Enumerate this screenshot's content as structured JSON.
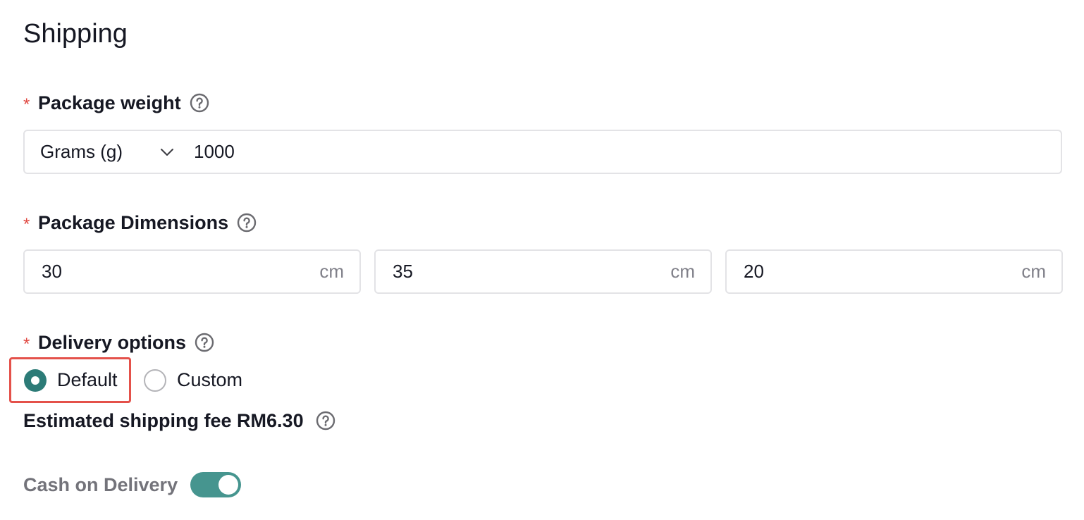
{
  "section_title": "Shipping",
  "package_weight": {
    "required_mark": "*",
    "label": "Package weight",
    "unit": "Grams (g)",
    "value": "1000"
  },
  "package_dimensions": {
    "required_mark": "*",
    "label": "Package Dimensions",
    "fields": [
      {
        "value": "30",
        "unit": "cm"
      },
      {
        "value": "35",
        "unit": "cm"
      },
      {
        "value": "20",
        "unit": "cm"
      }
    ]
  },
  "delivery_options": {
    "required_mark": "*",
    "label": "Delivery options",
    "options": [
      {
        "label": "Default",
        "selected": true
      },
      {
        "label": "Custom",
        "selected": false
      }
    ]
  },
  "estimated_fee": "Estimated shipping fee RM6.30",
  "cash_on_delivery": {
    "label": "Cash on Delivery",
    "enabled": true
  },
  "colors": {
    "accent": "#2c7b77",
    "toggle": "#46958f",
    "required": "#e0463f",
    "highlight": "#e4514a"
  },
  "icons": {
    "help": "question-circle-icon",
    "dropdown": "chevron-down-icon"
  }
}
